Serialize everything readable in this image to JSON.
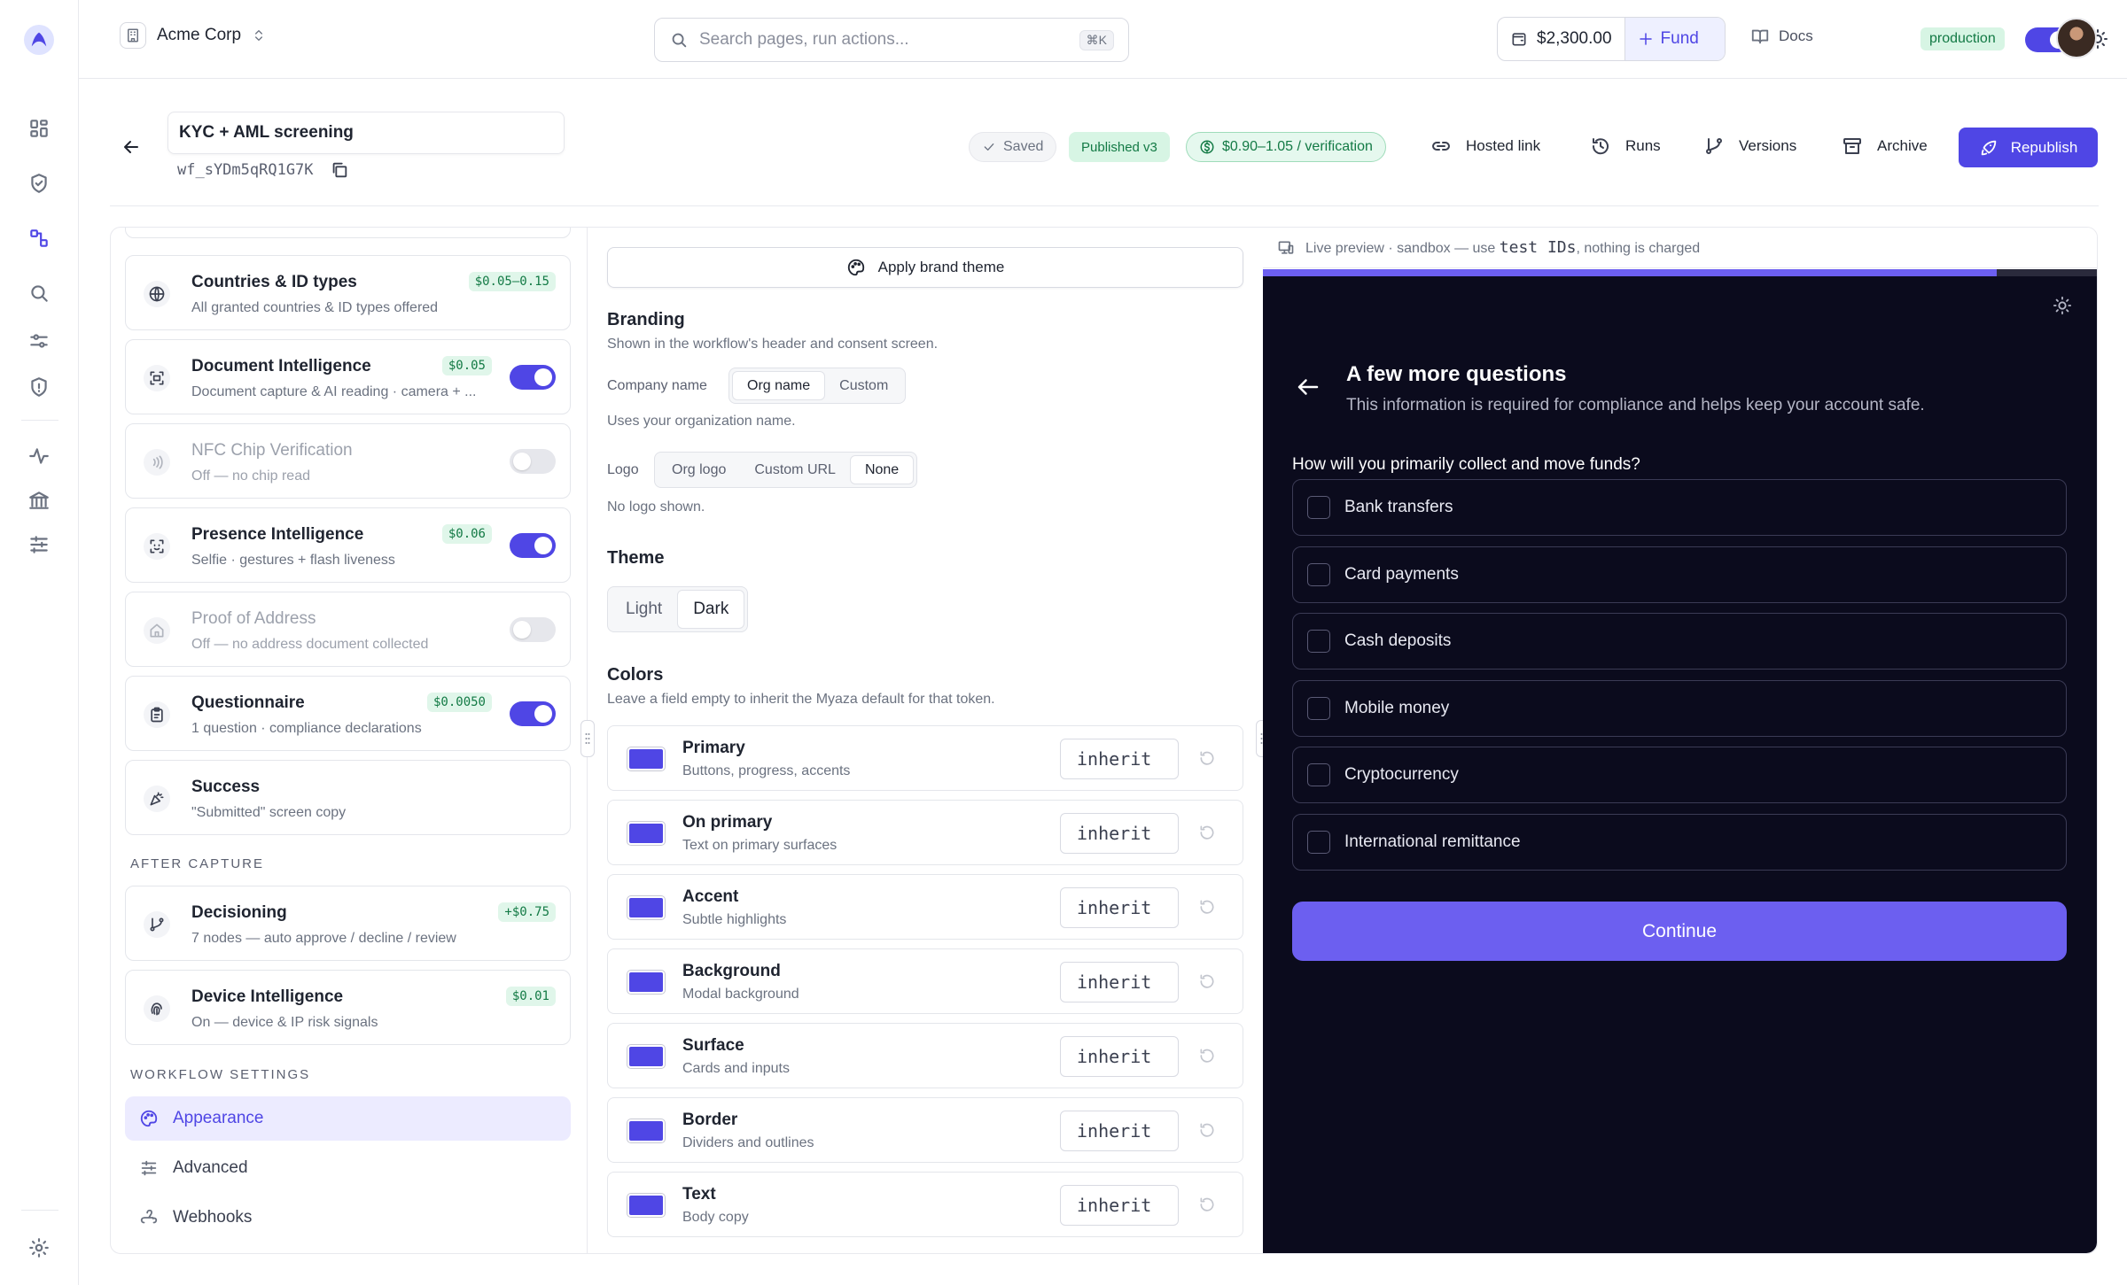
{
  "topbar": {
    "org_name": "Acme Corp",
    "search_placeholder": "Search pages, run actions...",
    "search_shortcut": "⌘K",
    "balance": "$2,300.00",
    "fund_label": "Fund",
    "docs_label": "Docs",
    "environment": "production"
  },
  "workflow": {
    "title": "KYC + AML screening",
    "id": "wf_sYDm5qRQ1G7K",
    "saved_label": "Saved",
    "published_label": "Published v3",
    "price_label": "$0.90–1.05 / verification",
    "actions": {
      "hosted_link": "Hosted link",
      "runs": "Runs",
      "versions": "Versions",
      "archive": "Archive",
      "republish": "Republish"
    }
  },
  "steps": [
    {
      "title": "Countries & ID types",
      "subtitle": "All granted countries & ID types offered",
      "cost": "$0.05–0.15",
      "toggle": null,
      "enabled": true
    },
    {
      "title": "Document Intelligence",
      "subtitle": "Document capture & AI reading · camera + ...",
      "cost": "$0.05",
      "toggle": true,
      "enabled": true
    },
    {
      "title": "NFC Chip Verification",
      "subtitle": "Off — no chip read",
      "cost": null,
      "toggle": false,
      "enabled": false
    },
    {
      "title": "Presence Intelligence",
      "subtitle": "Selfie · gestures + flash liveness",
      "cost": "$0.06",
      "toggle": true,
      "enabled": true
    },
    {
      "title": "Proof of Address",
      "subtitle": "Off — no address document collected",
      "cost": null,
      "toggle": false,
      "enabled": false
    },
    {
      "title": "Questionnaire",
      "subtitle": "1 question · compliance declarations",
      "cost": "$0.0050",
      "toggle": true,
      "enabled": true
    },
    {
      "title": "Success",
      "subtitle": "\"Submitted\" screen copy",
      "cost": null,
      "toggle": null,
      "enabled": true
    }
  ],
  "after_capture": {
    "heading": "AFTER CAPTURE",
    "steps": [
      {
        "title": "Decisioning",
        "subtitle": "7 nodes — auto approve / decline / review",
        "cost": "+$0.75"
      },
      {
        "title": "Device Intelligence",
        "subtitle": "On — device & IP risk signals",
        "cost": "$0.01"
      }
    ]
  },
  "workflow_settings": {
    "heading": "WORKFLOW SETTINGS",
    "items": [
      {
        "label": "Appearance",
        "active": true
      },
      {
        "label": "Advanced",
        "active": false
      },
      {
        "label": "Webhooks",
        "active": false
      }
    ]
  },
  "appearance": {
    "apply_brand_theme": "Apply brand theme",
    "branding": {
      "title": "Branding",
      "subtitle": "Shown in the workflow's header and consent screen.",
      "company_name_label": "Company name",
      "company_name_options": [
        "Org name",
        "Custom"
      ],
      "company_name_selected": "Org name",
      "company_name_hint": "Uses your organization name.",
      "logo_label": "Logo",
      "logo_options": [
        "Org logo",
        "Custom URL",
        "None"
      ],
      "logo_selected": "None",
      "logo_hint": "No logo shown."
    },
    "theme": {
      "title": "Theme",
      "options": [
        "Light",
        "Dark"
      ],
      "selected": "Dark"
    },
    "colors": {
      "title": "Colors",
      "subtitle": "Leave a field empty to inherit the Myaza default for that token.",
      "swatch_color": "#4f46e5",
      "tokens": [
        {
          "name": "Primary",
          "desc": "Buttons, progress, accents",
          "value": "inherit"
        },
        {
          "name": "On primary",
          "desc": "Text on primary surfaces",
          "value": "inherit"
        },
        {
          "name": "Accent",
          "desc": "Subtle highlights",
          "value": "inherit"
        },
        {
          "name": "Background",
          "desc": "Modal background",
          "value": "inherit"
        },
        {
          "name": "Surface",
          "desc": "Cards and inputs",
          "value": "inherit"
        },
        {
          "name": "Border",
          "desc": "Dividers and outlines",
          "value": "inherit"
        },
        {
          "name": "Text",
          "desc": "Body copy",
          "value": "inherit"
        }
      ]
    }
  },
  "preview": {
    "header_prefix": "Live preview · sandbox — use",
    "header_code": "test IDs",
    "header_suffix": ", nothing is charged",
    "progress": 0.88,
    "title": "A few more questions",
    "subtitle": "This information is required for compliance and helps keep your account safe.",
    "question": "How will you primarily collect and move funds?",
    "options": [
      "Bank transfers",
      "Card payments",
      "Cash deposits",
      "Mobile money",
      "Cryptocurrency",
      "International remittance"
    ],
    "continue_label": "Continue"
  },
  "colors": {
    "accent": "#4f46e5",
    "preview_bg": "#0b0b1d",
    "preview_accent": "#6c5ff0",
    "success_bg": "#d7f5e4"
  }
}
